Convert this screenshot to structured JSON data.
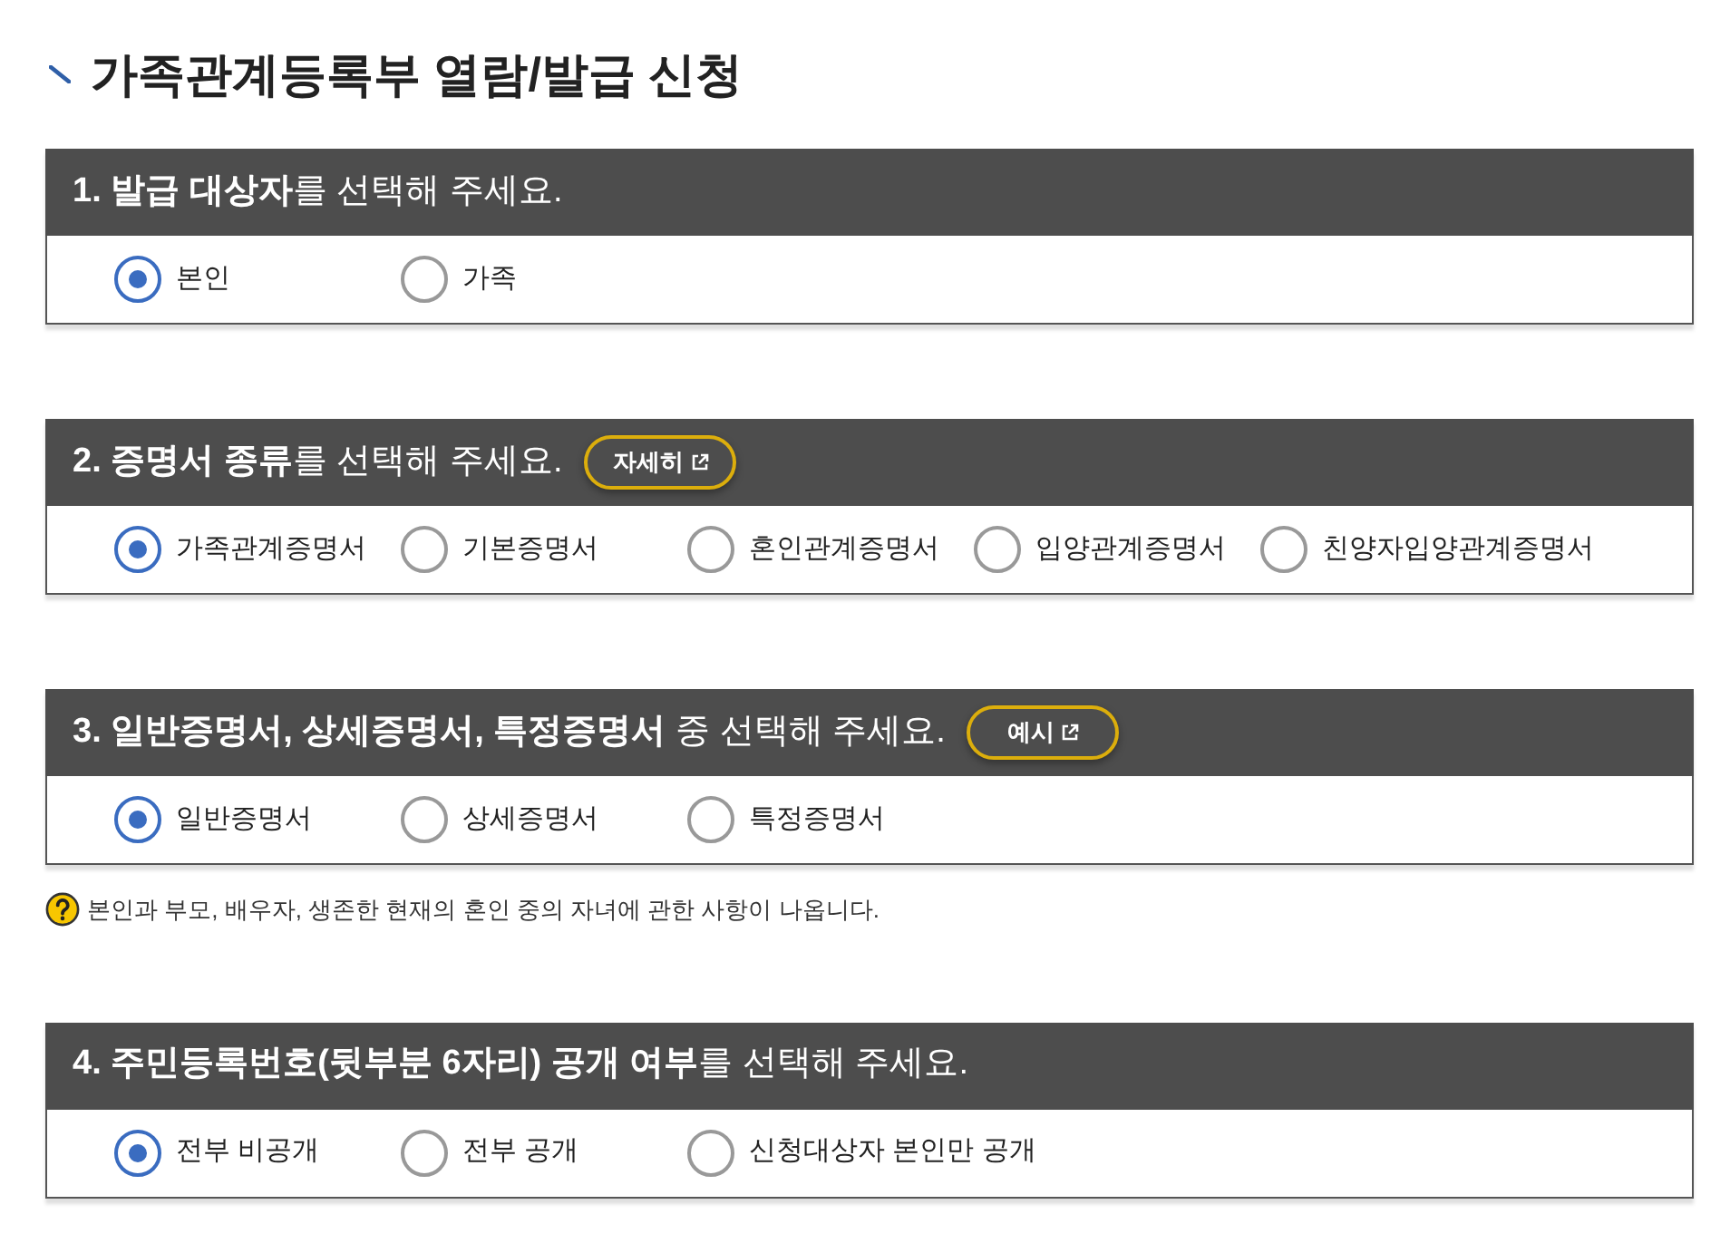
{
  "page_title": "가족관계등록부 열람/발급 신청",
  "sections": [
    {
      "heading": "**1. 발급 대상자**를 선택해 주세요.",
      "options": [
        {
          "label": "본인",
          "selected": true
        },
        {
          "label": "가족",
          "selected": false
        }
      ]
    },
    {
      "heading": "**2. 증명서 종류**를 선택해 주세요.",
      "button": {
        "label": "자세히"
      },
      "options": [
        {
          "label": "가족관계증명서",
          "selected": true
        },
        {
          "label": "기본증명서",
          "selected": false
        },
        {
          "label": "혼인관계증명서",
          "selected": false
        },
        {
          "label": "입양관계증명서",
          "selected": false
        },
        {
          "label": "친양자입양관계증명서",
          "selected": false
        }
      ]
    },
    {
      "heading": "**3. 일반증명서, 상세증명서, 특정증명서** 중 선택해 주세요.",
      "button": {
        "label": "예시"
      },
      "options": [
        {
          "label": "일반증명서",
          "selected": true
        },
        {
          "label": "상세증명서",
          "selected": false
        },
        {
          "label": "특정증명서",
          "selected": false
        }
      ],
      "note": "본인과 부모, 배우자, 생존한 현재의 혼인 중의 자녀에 관한 사항이 나옵니다."
    },
    {
      "heading": "**4. 주민등록번호(뒷부분 6자리) 공개 여부**를 선택해 주세요.",
      "options": [
        {
          "label": "전부 비공개",
          "selected": true
        },
        {
          "label": "전부 공개",
          "selected": false
        },
        {
          "label": "신청대상자 본인만 공개",
          "selected": false
        }
      ]
    }
  ]
}
